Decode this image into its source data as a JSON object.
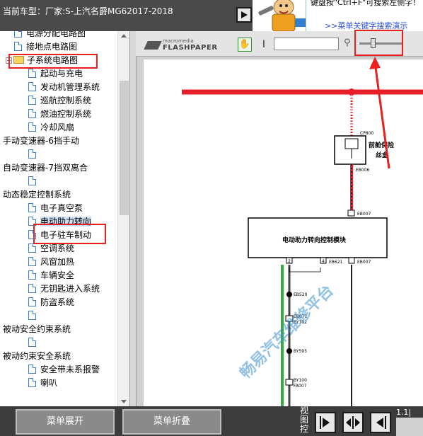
{
  "header": {
    "vehicle_label": "当前车型：厂家:S-上汽名爵MG62017-2018",
    "tip_text": "键盘按\"Ctrl+F\"可搜索左侧字！",
    "tip_link": ">>菜单关键字搜索演示"
  },
  "tree": {
    "items": [
      {
        "label": "电源分配电路图",
        "indent": 2,
        "icon": "doc-icon"
      },
      {
        "label": "接地点电路图",
        "indent": 2,
        "icon": "doc-icon"
      },
      {
        "label": "子系统电路图",
        "indent": 1,
        "icon": "folder-icon",
        "expander": "−"
      },
      {
        "label": "起动与充电",
        "indent": 3,
        "icon": "doc-icon"
      },
      {
        "label": "发动机管理系统",
        "indent": 3,
        "icon": "doc-icon"
      },
      {
        "label": "巡航控制系统",
        "indent": 3,
        "icon": "doc-icon"
      },
      {
        "label": "燃油控制系统",
        "indent": 3,
        "icon": "doc-icon"
      },
      {
        "label": "冷却风扇",
        "indent": 3,
        "icon": "doc-icon"
      },
      {
        "label": "手动变速器-6挡手动",
        "indent": 0,
        "icon": ""
      },
      {
        "label": "",
        "indent": 3,
        "icon": "doc-icon"
      },
      {
        "label": "自动变速器-7挡双离合",
        "indent": 0,
        "icon": ""
      },
      {
        "label": "",
        "indent": 3,
        "icon": "doc-icon"
      },
      {
        "label": "动态稳定控制系统",
        "indent": 0,
        "icon": ""
      },
      {
        "label": "电子真空泵",
        "indent": 3,
        "icon": "doc-icon"
      },
      {
        "label": "电动助力转向",
        "indent": 3,
        "icon": "doc-icon",
        "selected": true
      },
      {
        "label": "电子驻车制动",
        "indent": 3,
        "icon": "doc-icon"
      },
      {
        "label": "空调系统",
        "indent": 3,
        "icon": "doc-icon"
      },
      {
        "label": "风窗加热",
        "indent": 3,
        "icon": "doc-icon"
      },
      {
        "label": "车辆安全",
        "indent": 3,
        "icon": "doc-icon"
      },
      {
        "label": "无钥匙进入系统",
        "indent": 3,
        "icon": "doc-icon"
      },
      {
        "label": "防盗系统",
        "indent": 3,
        "icon": "doc-icon"
      },
      {
        "label": "",
        "indent": 3,
        "icon": "doc-icon"
      },
      {
        "label": "被动安全约束系统",
        "indent": 0,
        "icon": ""
      },
      {
        "label": "",
        "indent": 3,
        "icon": "doc-icon"
      },
      {
        "label": "被动约束安全系统",
        "indent": 0,
        "icon": ""
      },
      {
        "label": "安全带未系报警",
        "indent": 3,
        "icon": "doc-icon"
      },
      {
        "label": "喇叭",
        "indent": 3,
        "icon": "doc-icon"
      }
    ]
  },
  "viewer": {
    "logo_small": "macromedia",
    "logo_big": "FLASHPAPER"
  },
  "diagram": {
    "fuse_box_code": "CP800",
    "fuse_box_label_1": "前舱保险",
    "fuse_box_label_2": "丝盒",
    "conn_top": "EB006",
    "conn_mid": "EB007",
    "module_label": "电动助力转向控制模块",
    "module_pin_left": "2",
    "module_pin_right": "4",
    "module_conn_left": "EB621",
    "module_conn_right": "EB007",
    "wire_ids": [
      "EB520",
      "EB071",
      "BY102",
      "BY595",
      "BY100",
      "FA007"
    ],
    "watermark": "畅易汽车维修平台"
  },
  "bottom": {
    "expand_label": "菜单展开",
    "collapse_label": "菜单折叠",
    "view_label": "视图控",
    "page_count": "1.1|"
  },
  "colors": {
    "annotation": "#e82020",
    "wire_red": "#e81f2a",
    "wire_green": "#3aa845",
    "watermark": "#3a8fd0"
  }
}
